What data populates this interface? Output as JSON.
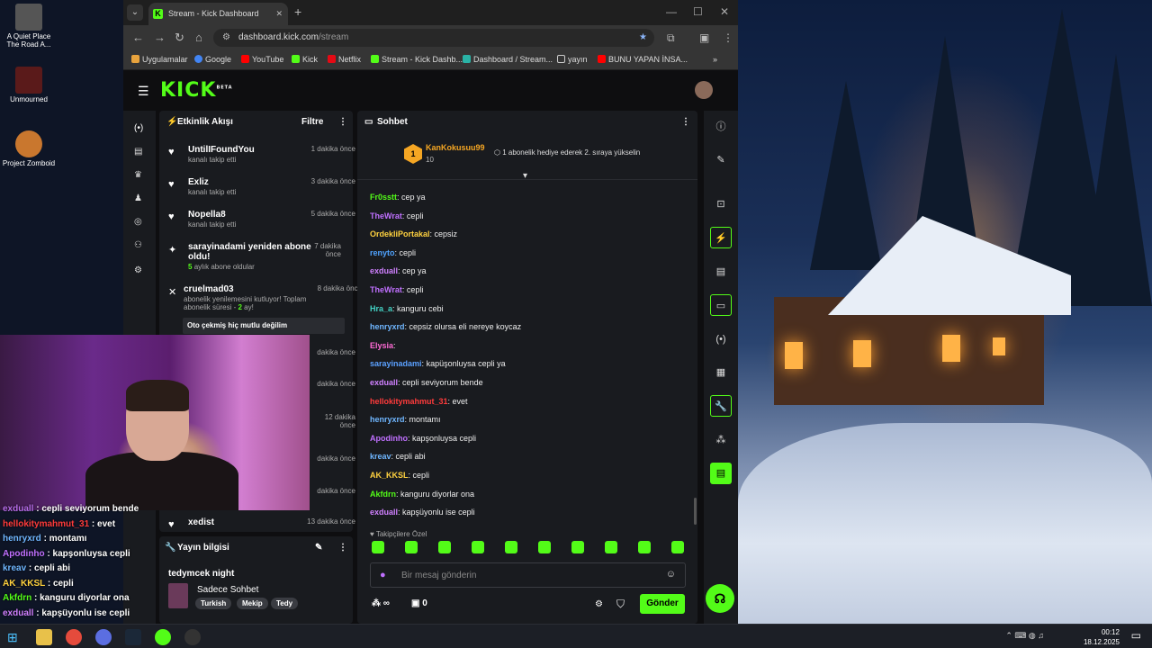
{
  "desktop": {
    "icons": [
      {
        "label": "A Quiet Place The Road A..."
      },
      {
        "label": "Unmourned"
      },
      {
        "label": "Project Zomboid"
      }
    ]
  },
  "browser": {
    "tab_title": "Stream - Kick Dashboard",
    "url_domain": "dashboard.kick.com",
    "url_path": "/stream",
    "bookmarks": [
      "Uygulamalar",
      "Google",
      "YouTube",
      "Kick",
      "Netflix",
      "Stream - Kick Dashb...",
      "Dashboard / Stream...",
      "yayın",
      "BUNU YAPAN İNSA..."
    ]
  },
  "kick": {
    "logo": "KICK",
    "logo_badge": "BETA",
    "activity": {
      "title": "Etkinlik Akışı",
      "filter_label": "Filtre",
      "items": [
        {
          "name": "UntilIFoundYou",
          "sub": "kanalı takip etti",
          "time": "1 dakika önce"
        },
        {
          "name": "Exliz",
          "sub": "kanalı takip etti",
          "time": "3 dakika önce"
        },
        {
          "name": "Nopella8",
          "sub": "kanalı takip etti",
          "time": "5 dakika önce"
        },
        {
          "name": "sarayinadami yeniden abone oldu!",
          "sub": "aylık abone oldular",
          "months": "5",
          "time": "7 dakika önce"
        },
        {
          "name": "cruelmad03",
          "sub_prefix": "abonelik yenilemesini kutluyor! Toplam abonelik süresi - ",
          "months": "2",
          "sub_suffix": " ay!",
          "message": "Oto çekmiş hiç mutlu değilim",
          "time": "8 dakika önce"
        },
        {
          "time": "dakika önce"
        },
        {
          "time": "dakika önce"
        },
        {
          "time": "12 dakika önce"
        },
        {
          "time": "dakika önce"
        },
        {
          "time": "dakika önce"
        },
        {
          "name": "xedist",
          "time": "13 dakika önce"
        }
      ]
    },
    "stream_info": {
      "title": "Yayın bilgisi",
      "stream_title": "tedymcek night",
      "category": "Sadece Sohbet",
      "tags": [
        "Turkish",
        "Mekip",
        "Tedy"
      ]
    },
    "chat": {
      "title": "Sohbet",
      "top_gifter": {
        "name": "KanKokusuu99",
        "rank": "1",
        "count": "10"
      },
      "promo": "1 abonelik hediye ederek 2. sıraya yükselin",
      "messages": [
        {
          "user": "Fr0sstt",
          "color": "#53fc18",
          "text": "cep ya"
        },
        {
          "user": "TheWrat",
          "color": "#c070ff",
          "text": "cepli"
        },
        {
          "user": "OrdekliPortakal",
          "color": "#ffd23f",
          "text": "cepsiz"
        },
        {
          "user": "renyto",
          "color": "#4fa3ff",
          "text": "cepli"
        },
        {
          "user": "exduall",
          "color": "#d080ff",
          "text": "cep ya"
        },
        {
          "user": "TheWrat",
          "color": "#c070ff",
          "text": "cepli"
        },
        {
          "user": "Hra_a",
          "color": "#43d3c5",
          "text": "kanguru cebi"
        },
        {
          "user": "henryxrd",
          "color": "#6fb6ff",
          "text": "cepsiz olursa eli nereye koycaz"
        },
        {
          "user": "Elysia",
          "color": "#ff6ad5",
          "text": ""
        },
        {
          "user": "sarayinadami",
          "color": "#5aa0ff",
          "text": "kapüşonluysa cepli ya"
        },
        {
          "user": "exduall",
          "color": "#d080ff",
          "text": "cepli seviyorum bende"
        },
        {
          "user": "hellokitymahmut_31",
          "color": "#ff3b3b",
          "text": "evet"
        },
        {
          "user": "henryxrd",
          "color": "#6fb6ff",
          "text": "montamı"
        },
        {
          "user": "Apodinho",
          "color": "#c070ff",
          "text": "kapşonluysa cepli"
        },
        {
          "user": "kreav",
          "color": "#6fb6ff",
          "text": "cepli abi"
        },
        {
          "user": "AK_KKSL",
          "color": "#ffd23f",
          "text": "cepli"
        },
        {
          "user": "Akfdrn",
          "color": "#53fc18",
          "text": "kanguru diyorlar ona"
        },
        {
          "user": "exduall",
          "color": "#d080ff",
          "text": "kapşüyonlu ise cepli"
        }
      ],
      "followers_only": "Takipçilere Özel",
      "input_placeholder": "Bir mesaj gönderin",
      "points": "∞",
      "gift_count": "0",
      "send_label": "Gönder"
    }
  },
  "overlay_chat": [
    {
      "user": "exduall",
      "color": "#b66ce8",
      "text": "cepli seviyorum bende"
    },
    {
      "user": "hellokitymahmut_31",
      "color": "#ff3b3b",
      "text": "evet"
    },
    {
      "user": "henryxrd",
      "color": "#6fb6ff",
      "text": "montamı"
    },
    {
      "user": "Apodinho",
      "color": "#c070ff",
      "text": "kapşonluysa cepli"
    },
    {
      "user": "kreav",
      "color": "#6fb6ff",
      "text": "cepli abi"
    },
    {
      "user": "AK_KKSL",
      "color": "#ffd23f",
      "text": "cepli"
    },
    {
      "user": "Akfdrn",
      "color": "#53fc18",
      "text": "kanguru diyorlar ona"
    },
    {
      "user": "exduall",
      "color": "#d080ff",
      "text": "kapşüyonlu ise cepli"
    }
  ],
  "taskbar": {
    "time": "00:12",
    "date": "18.12.2025"
  }
}
